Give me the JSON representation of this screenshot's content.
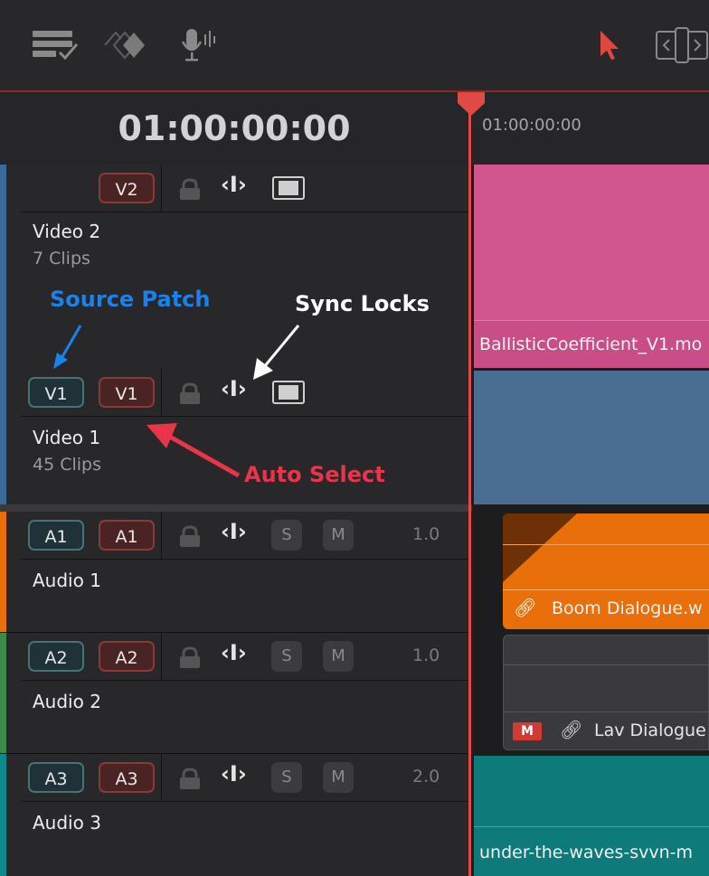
{
  "timecode": "01:00:00:00",
  "ruler_timecode": "01:00:00:00",
  "tracks": [
    {
      "name": "Video 2",
      "clips": "7 Clips",
      "src": "",
      "dest": "V2"
    },
    {
      "name": "Video 1",
      "clips": "45 Clips",
      "src": "V1",
      "dest": "V1"
    },
    {
      "name": "Audio 1",
      "src": "A1",
      "dest": "A1",
      "solo": "S",
      "mute": "M",
      "volume": "1.0"
    },
    {
      "name": "Audio 2",
      "src": "A2",
      "dest": "A2",
      "solo": "S",
      "mute": "M",
      "volume": "1.0"
    },
    {
      "name": "Audio 3",
      "src": "A3",
      "dest": "A3",
      "solo": "S",
      "mute": "M",
      "volume": "2.0"
    }
  ],
  "clips": {
    "v2": "BallisticCoefficient_V1.mo",
    "a1": "Boom Dialogue.w",
    "a2": "Lav Dialogue",
    "a2_badge": "M",
    "a3": "under-the-waves-svvn-m"
  },
  "annotations": {
    "source_patch": "Source Patch",
    "sync_locks": "Sync Locks",
    "auto_select": "Auto Select"
  },
  "colors": {
    "v2_clip": "#d1568e",
    "v1_clip": "#4a6e92",
    "a1_clip": "#e86f0a",
    "a3_clip": "#0e7a7a",
    "playhead": "#e04a44",
    "source_patch_annotation": "#1a82e8",
    "auto_select_annotation": "#e8354a",
    "sync_locks_annotation": "#ffffff"
  }
}
